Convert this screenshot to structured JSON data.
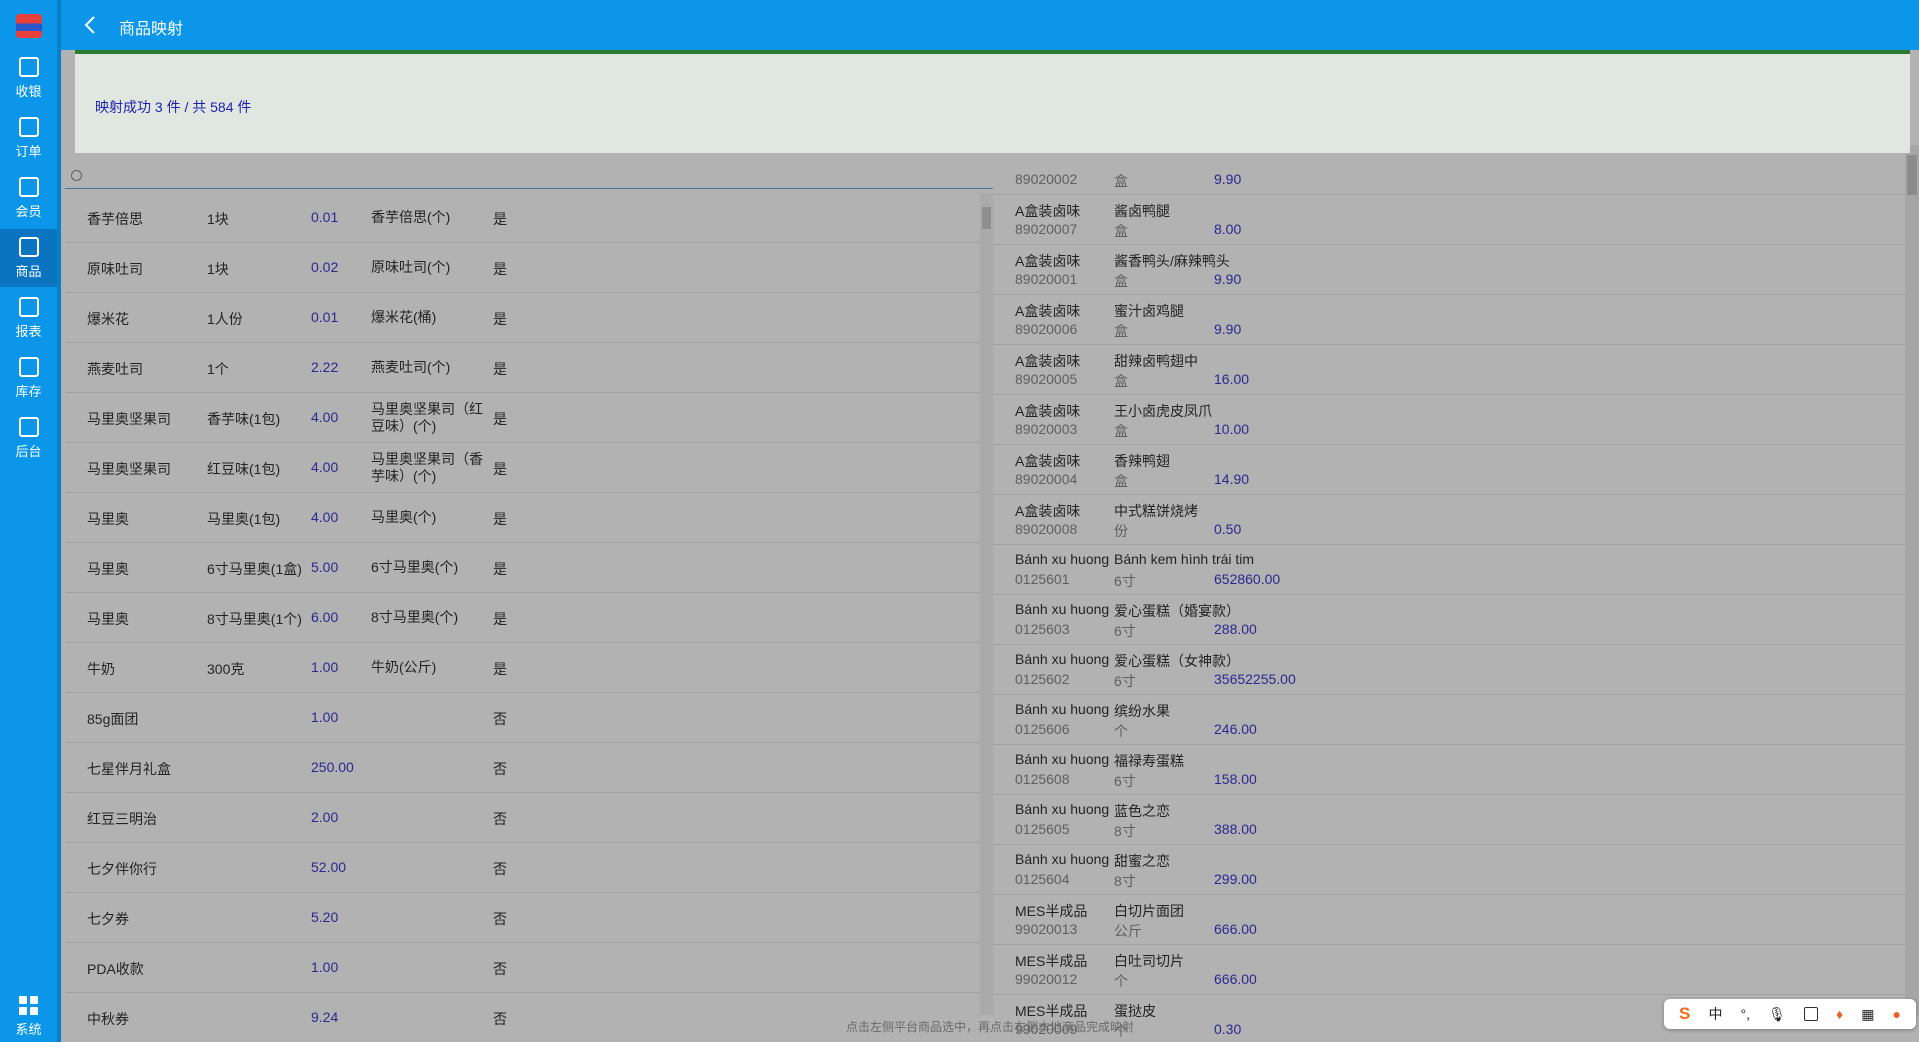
{
  "nav": {
    "items": [
      {
        "label": "收银",
        "icon": "cash-register-icon"
      },
      {
        "label": "订单",
        "icon": "order-icon"
      },
      {
        "label": "会员",
        "icon": "member-icon"
      },
      {
        "label": "商品",
        "icon": "product-icon"
      },
      {
        "label": "报表",
        "icon": "report-icon"
      },
      {
        "label": "库存",
        "icon": "warehouse-icon"
      },
      {
        "label": "后台",
        "icon": "store-icon"
      }
    ],
    "system_label": "系统"
  },
  "header": {
    "title": "商品映射"
  },
  "toast": {
    "message": "映射成功 3 件 / 共 584 件"
  },
  "left": {
    "rows": [
      [
        "香芋倍思",
        "1块",
        "0.01",
        "香芋倍思(个)",
        "是"
      ],
      [
        "原味吐司",
        "1块",
        "0.02",
        "原味吐司(个)",
        "是"
      ],
      [
        "爆米花",
        "1人份",
        "0.01",
        "爆米花(桶)",
        "是"
      ],
      [
        "燕麦吐司",
        "1个",
        "2.22",
        "燕麦吐司(个)",
        "是"
      ],
      [
        "马里奥坚果司",
        "香芋味(1包)",
        "4.00",
        "马里奥坚果司（红豆味）(个)",
        "是"
      ],
      [
        "马里奥坚果司",
        "红豆味(1包)",
        "4.00",
        "马里奥坚果司（香芋味）(个)",
        "是"
      ],
      [
        "马里奥",
        "马里奥(1包)",
        "4.00",
        "马里奥(个)",
        "是"
      ],
      [
        "马里奥",
        "6寸马里奥(1盒)",
        "5.00",
        "6寸马里奥(个)",
        "是"
      ],
      [
        "马里奥",
        "8寸马里奥(1个)",
        "6.00",
        "8寸马里奥(个)",
        "是"
      ],
      [
        "牛奶",
        "300克",
        "1.00",
        "牛奶(公斤)",
        "是"
      ],
      [
        "85g面团",
        "",
        "1.00",
        "",
        "否"
      ],
      [
        "七星伴月礼盒",
        "",
        "250.00",
        "",
        "否"
      ],
      [
        "红豆三明治",
        "",
        "2.00",
        "",
        "否"
      ],
      [
        "七夕伴你行",
        "",
        "52.00",
        "",
        "否"
      ],
      [
        "七夕券",
        "",
        "5.20",
        "",
        "否"
      ],
      [
        "PDA收款",
        "",
        "1.00",
        "",
        "否"
      ],
      [
        "中秋券",
        "",
        "9.24",
        "",
        "否"
      ]
    ]
  },
  "right": {
    "rows": [
      [
        "",
        "89020002",
        "",
        "盒",
        "9.90"
      ],
      [
        "A盒装卤味",
        "89020007",
        "酱卤鸭腿",
        "盒",
        "8.00"
      ],
      [
        "A盒装卤味",
        "89020001",
        "酱香鸭头/麻辣鸭头",
        "盒",
        "9.90"
      ],
      [
        "A盒装卤味",
        "89020006",
        "蜜汁卤鸡腿",
        "盒",
        "9.90"
      ],
      [
        "A盒装卤味",
        "89020005",
        "甜辣卤鸭翅中",
        "盒",
        "16.00"
      ],
      [
        "A盒装卤味",
        "89020003",
        "王小卤虎皮凤爪",
        "盒",
        "10.00"
      ],
      [
        "A盒装卤味",
        "89020004",
        "香辣鸭翅",
        "盒",
        "14.90"
      ],
      [
        "A盒装卤味",
        "89020008",
        "中式糕饼烧烤",
        "份",
        "0.50"
      ],
      [
        "Bánh xu huong",
        "0125601",
        "Bánh kem hình trái tim",
        "6寸",
        "652860.00"
      ],
      [
        "Bánh xu huong",
        "0125603",
        "爱心蛋糕（婚宴款）",
        "6寸",
        "288.00"
      ],
      [
        "Bánh xu huong",
        "0125602",
        "爱心蛋糕（女神款）",
        "6寸",
        "35652255.00"
      ],
      [
        "Bánh xu huong",
        "0125606",
        "缤纷水果",
        "个",
        "246.00"
      ],
      [
        "Bánh xu huong",
        "0125608",
        "福禄寿蛋糕",
        "6寸",
        "158.00"
      ],
      [
        "Bánh xu huong",
        "0125605",
        "蓝色之恋",
        "8寸",
        "388.00"
      ],
      [
        "Bánh xu huong",
        "0125604",
        "甜蜜之恋",
        "8寸",
        "299.00"
      ],
      [
        "MES半成品",
        "99020013",
        "白切片面团",
        "公斤",
        "666.00"
      ],
      [
        "MES半成品",
        "99020012",
        "白吐司切片",
        "个",
        "666.00"
      ],
      [
        "MES半成品",
        "99020009",
        "蛋挞皮",
        "个",
        "0.30"
      ]
    ]
  },
  "hint": "点击左侧平台商品选中，再点击右侧本地商品完成映射",
  "ime": {
    "mode": "中",
    "punct": "°,"
  },
  "colors": {
    "brand": "#0b96ea",
    "toast_bg": "#e0e7e0",
    "toast_border": "#2c7a2c",
    "price": "#3a3ad0"
  }
}
